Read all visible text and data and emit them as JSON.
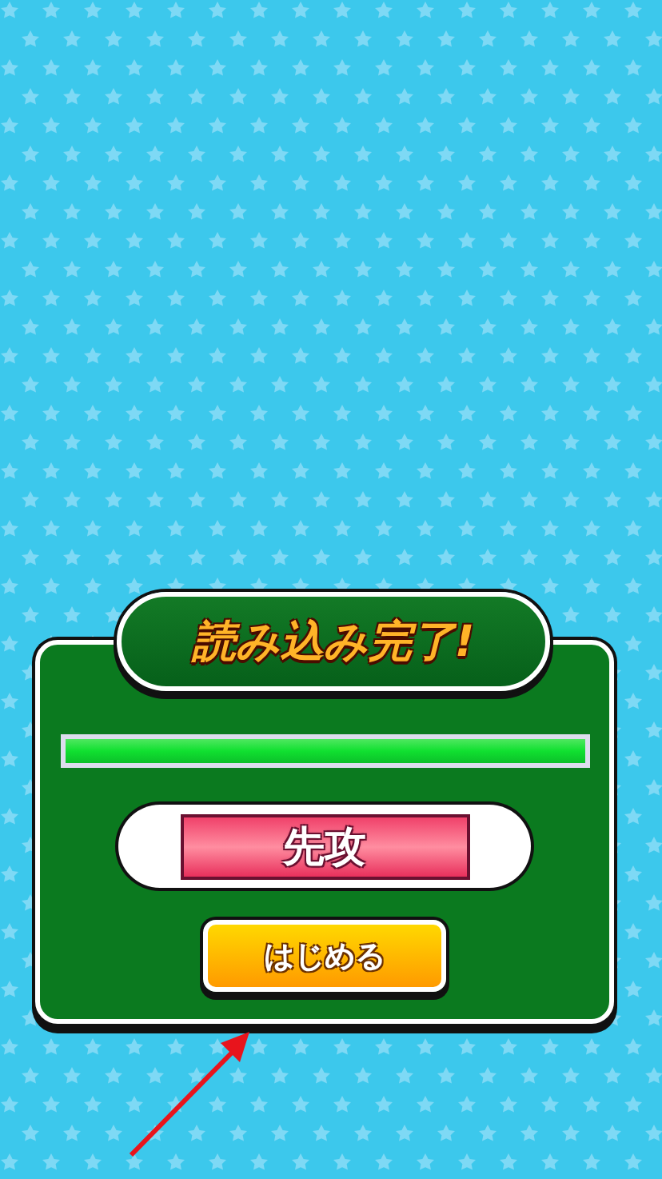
{
  "dialog": {
    "title": "読み込み完了!",
    "progress": {
      "level": 1.0
    },
    "turn_label": "先攻",
    "start_button": "はじめる"
  }
}
